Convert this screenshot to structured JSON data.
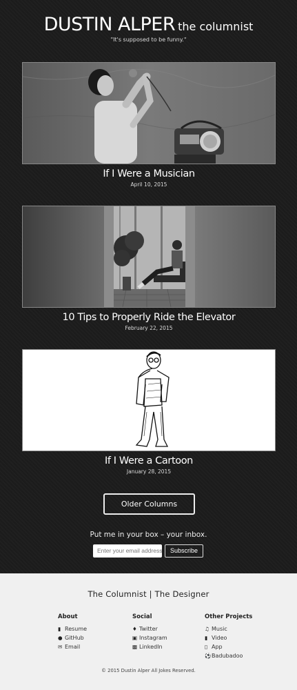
{
  "header": {
    "site_name": "DUSTIN ALPER",
    "site_subtitle": "the columnist",
    "tagline": "\"It's supposed to be funny.\""
  },
  "posts": [
    {
      "title": "If I Were a Musician",
      "date": "April 10, 2015"
    },
    {
      "title": "10 Tips to Properly Ride the Elevator",
      "date": "February 22, 2015"
    },
    {
      "title": "If I Were a Cartoon",
      "date": "January 28, 2015"
    }
  ],
  "older_button": "Older Columns",
  "newsletter": {
    "text": "Put me in your box – your inbox.",
    "placeholder": "Enter your email address",
    "button": "Subscribe"
  },
  "footer": {
    "title": "The Columnist | The Designer",
    "columns": [
      {
        "heading": "About",
        "items": [
          {
            "label": "Resume",
            "icon": "file-icon"
          },
          {
            "label": "GitHub",
            "icon": "github-icon"
          },
          {
            "label": "Email",
            "icon": "envelope-icon"
          }
        ]
      },
      {
        "heading": "Social",
        "items": [
          {
            "label": "Twitter",
            "icon": "twitter-icon"
          },
          {
            "label": "Instagram",
            "icon": "instagram-icon"
          },
          {
            "label": "LinkedIn",
            "icon": "linkedin-icon"
          }
        ]
      },
      {
        "heading": "Other Projects",
        "items": [
          {
            "label": "Music",
            "icon": "music-icon"
          },
          {
            "label": "Video",
            "icon": "video-icon"
          },
          {
            "label": "App",
            "icon": "mobile-icon"
          },
          {
            "label": "Badubadoo",
            "icon": "soccer-ball-icon"
          }
        ]
      }
    ],
    "copyright": "© 2015 Dustin Alper All Jokes Reserved."
  }
}
